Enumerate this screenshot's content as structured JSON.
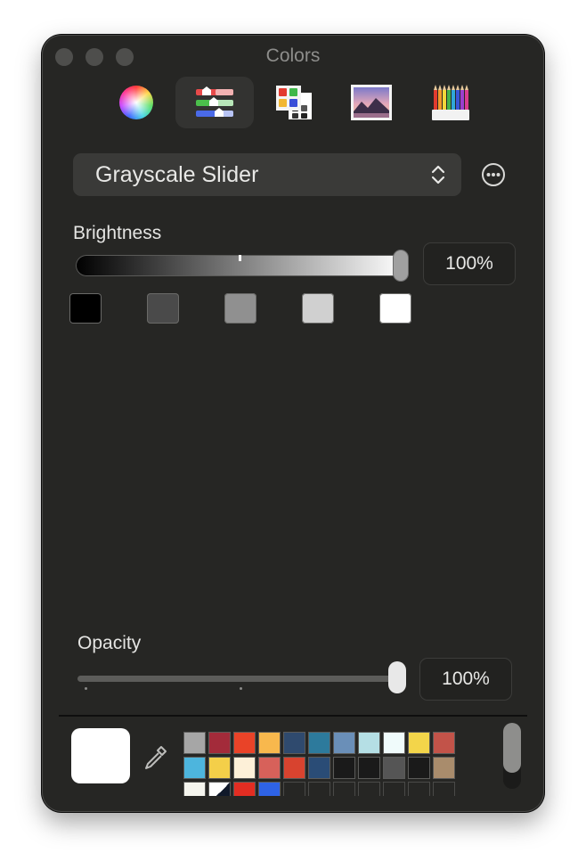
{
  "window": {
    "title": "Colors"
  },
  "toolbar": {
    "tabs": [
      {
        "name": "color-wheel",
        "icon": "color-wheel-icon"
      },
      {
        "name": "color-sliders",
        "icon": "sliders-icon",
        "active": true
      },
      {
        "name": "color-palettes",
        "icon": "palette-icon"
      },
      {
        "name": "image-palettes",
        "icon": "image-icon"
      },
      {
        "name": "pencils",
        "icon": "pencils-icon"
      }
    ]
  },
  "slider_mode": {
    "selected": "Grayscale Slider",
    "more_icon": "ellipsis-circle-icon"
  },
  "brightness": {
    "label": "Brightness",
    "value": 100,
    "value_text": "100%"
  },
  "gray_presets": [
    "#000000",
    "#4a4a4a",
    "#909090",
    "#d0d0d0",
    "#ffffff"
  ],
  "opacity": {
    "label": "Opacity",
    "value": 100,
    "value_text": "100%"
  },
  "current_color": "#ffffff",
  "swatch_grid": [
    [
      "#a6a6a6",
      "#a32b3a",
      "#e94328",
      "#f8b84d",
      "#2f4a6e",
      "#2d7a9c",
      "#6a8fb8",
      "#b5dfe5",
      "#f0fbfb",
      "#f3d54a",
      "#c25349"
    ],
    [
      "#4db5dd",
      "#f4cf49",
      "#fdf0d8",
      "#d7615a",
      "#d8432f",
      "#2a4c76",
      "#1a1a1a",
      "#1a1a1a",
      "#555555",
      "#1a1a1a",
      "#a98c6c"
    ],
    [
      "#f5f5ee",
      "split-black-white",
      "#e22d22",
      "#2e63e6",
      "empty",
      "empty",
      "empty",
      "empty",
      "empty",
      "empty",
      "empty"
    ]
  ]
}
